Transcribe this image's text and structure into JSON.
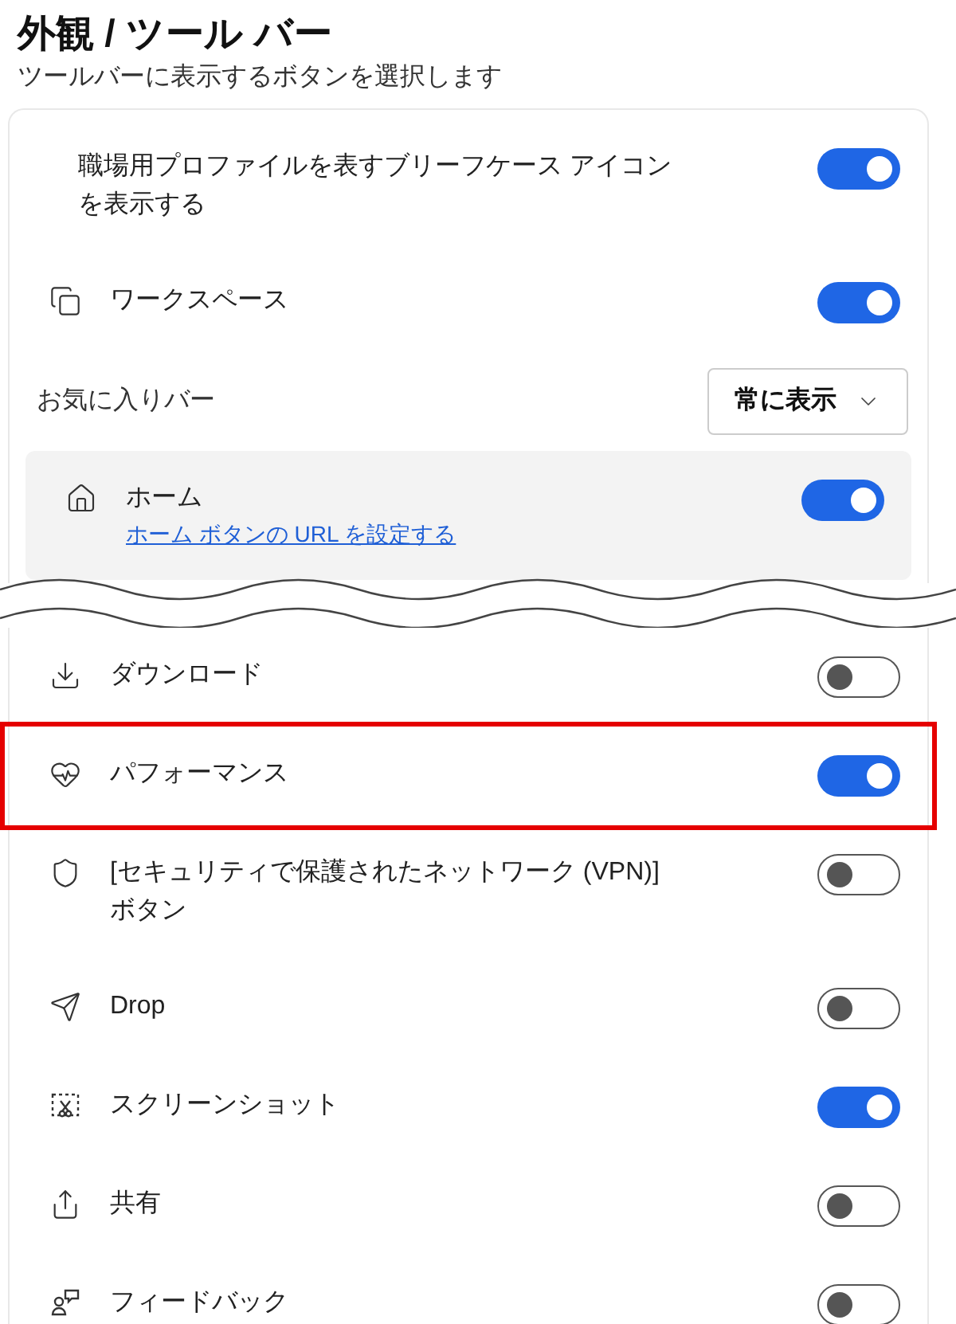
{
  "header": {
    "title": "外観 / ツール バー",
    "subtitle": "ツールバーに表示するボタンを選択します"
  },
  "rows_before_break": [
    {
      "kind": "toggle",
      "label": "職場用プロファイルを表すブリーフケース アイコンを表示する",
      "on": true,
      "hovered": false,
      "outlined": false
    },
    {
      "kind": "toggle",
      "label": "ワークスペース",
      "on": true,
      "hovered": false,
      "outlined": false
    },
    {
      "kind": "select",
      "label": "お気に入りバー",
      "value": "常に表示"
    },
    {
      "kind": "toggle",
      "label": "ホーム",
      "link": "ホーム ボタンの URL を設定する",
      "on": true,
      "hovered": true,
      "outlined": false
    }
  ],
  "rows_after_break": [
    {
      "kind": "toggle",
      "label": "ダウンロード",
      "on": false,
      "hovered": false,
      "outlined": false
    },
    {
      "kind": "toggle",
      "label": "パフォーマンス",
      "on": true,
      "hovered": false,
      "outlined": true
    },
    {
      "kind": "toggle",
      "label": "[セキュリティで保護されたネットワーク (VPN)] ボタン",
      "on": false,
      "hovered": false,
      "outlined": false
    },
    {
      "kind": "toggle",
      "label": "Drop",
      "on": false,
      "hovered": false,
      "outlined": false
    },
    {
      "kind": "toggle",
      "label": "スクリーンショット",
      "on": true,
      "hovered": false,
      "outlined": false
    },
    {
      "kind": "toggle",
      "label": "共有",
      "on": false,
      "hovered": false,
      "outlined": false
    },
    {
      "kind": "toggle",
      "label": "フィードバック",
      "on": false,
      "hovered": false,
      "outlined": false
    }
  ]
}
